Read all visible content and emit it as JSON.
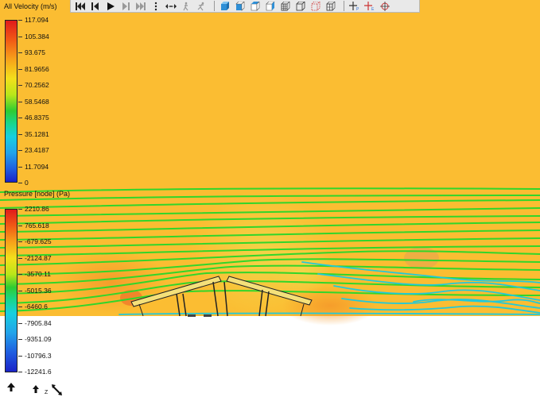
{
  "toolbar": {
    "buttons": [
      {
        "name": "first-frame-button",
        "icon": "skip-to-start-icon"
      },
      {
        "name": "step-back-button",
        "icon": "step-back-icon"
      },
      {
        "name": "play-button",
        "icon": "play-icon"
      },
      {
        "name": "step-forward-button",
        "icon": "step-forward-icon"
      },
      {
        "name": "last-frame-button",
        "icon": "skip-to-end-icon"
      },
      {
        "name": "more-button",
        "icon": "vertical-ellipsis-icon"
      },
      {
        "name": "pan-button",
        "icon": "pan-arrows-icon"
      },
      {
        "name": "walk-button",
        "icon": "walk-icon"
      },
      {
        "name": "run-button",
        "icon": "run-icon"
      },
      {
        "name": "view-iso-button",
        "icon": "cube-iso-icon"
      },
      {
        "name": "view-front-button",
        "icon": "cube-front-icon"
      },
      {
        "name": "view-top-button",
        "icon": "cube-top-icon"
      },
      {
        "name": "view-side-button",
        "icon": "cube-side-icon"
      },
      {
        "name": "wireframe-button",
        "icon": "wireframe-cube-icon"
      },
      {
        "name": "outline-button",
        "icon": "outline-cube-icon"
      },
      {
        "name": "hidden-lines-button",
        "icon": "dashed-cube-icon"
      },
      {
        "name": "mesh-button",
        "icon": "mesh-cube-icon"
      },
      {
        "name": "probe-p-button",
        "icon": "crosshair-p-icon"
      },
      {
        "name": "probe-e-button",
        "icon": "crosshair-e-icon"
      },
      {
        "name": "probe-target-button",
        "icon": "target-icon"
      }
    ]
  },
  "velocity_legend": {
    "title": "All Velocity (m/s)",
    "ticks": [
      "117.094",
      "105.384",
      "93.675",
      "81.9656",
      "70.2562",
      "58.5468",
      "46.8375",
      "35.1281",
      "23.4187",
      "11.7094",
      "0"
    ]
  },
  "pressure_legend": {
    "title": "Pressure [node] (Pa)",
    "ticks": [
      "2210.86",
      "765.618",
      "-679.625",
      "-2124.87",
      "-3570.11",
      "-5015.36",
      "-6460.6",
      "-7905.84",
      "-9351.09",
      "-10796.3",
      "-12241.6"
    ]
  },
  "triad": {
    "axis_label": "Z"
  },
  "colors": {
    "background_field": "#fbbd32",
    "streamline_green": "#31d62a",
    "streamline_cyan": "#22c9d8",
    "toolbar_bg": "#e9e9e9"
  }
}
